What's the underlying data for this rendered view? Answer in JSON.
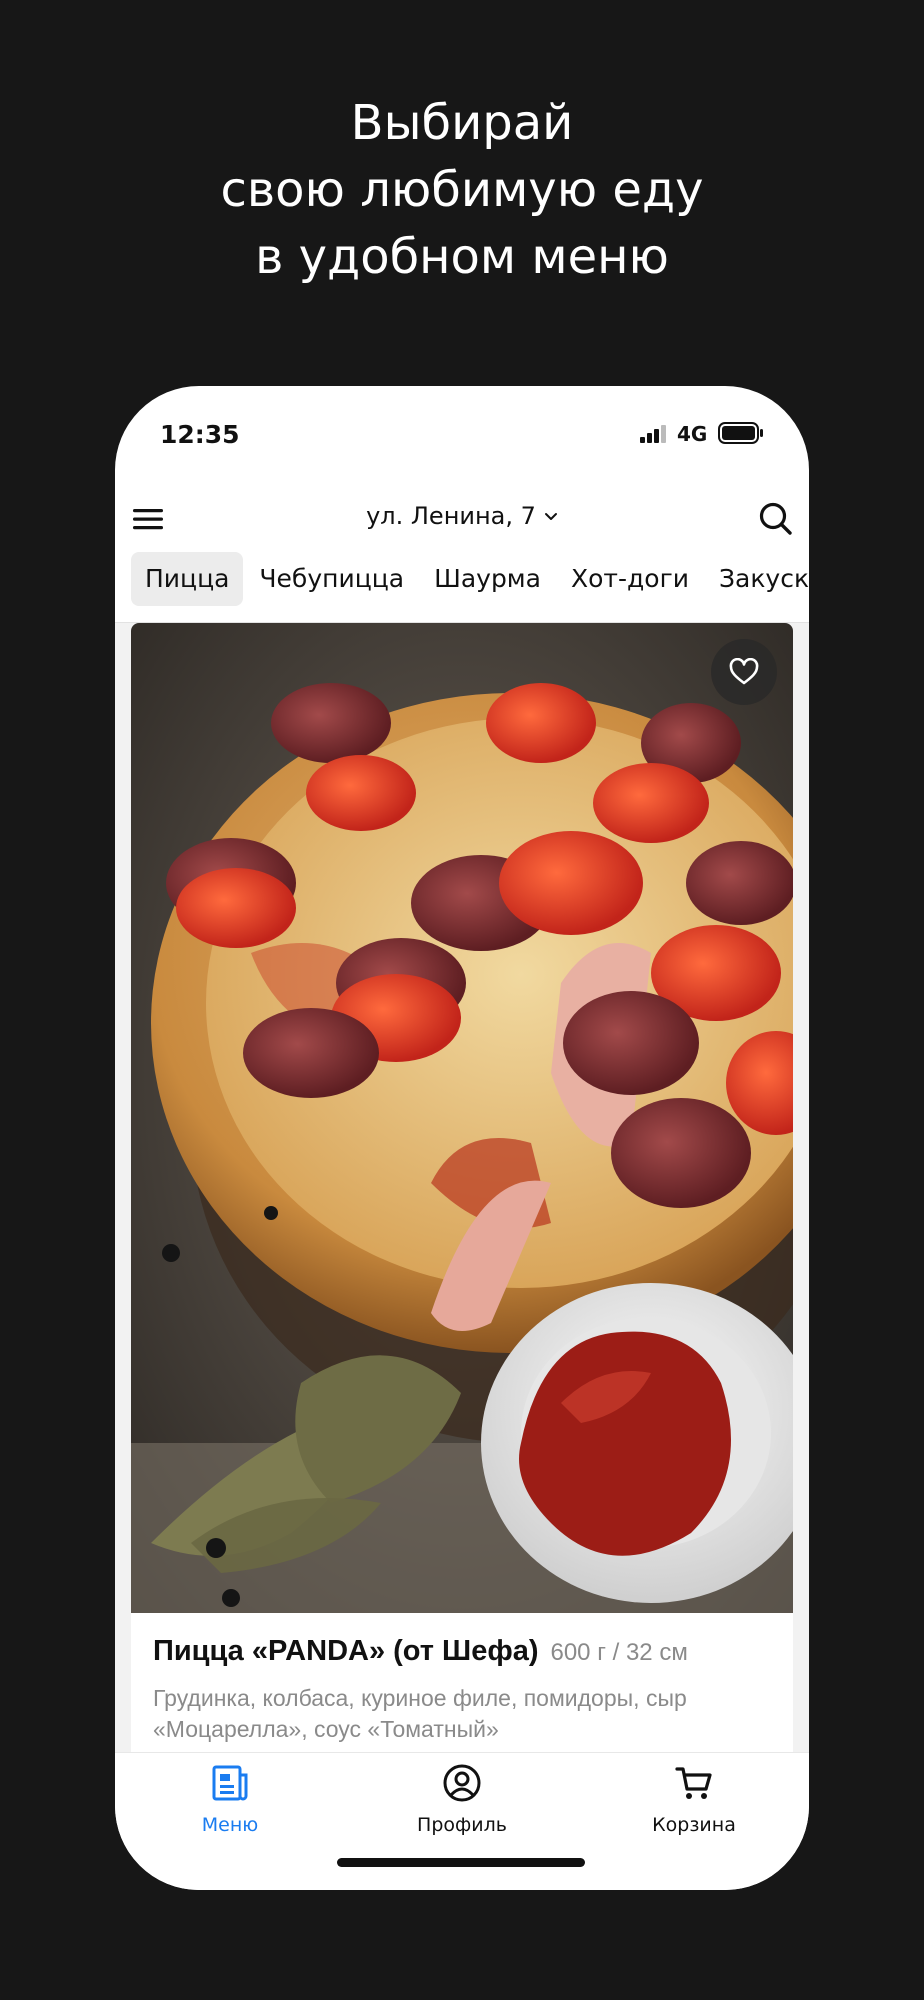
{
  "headline": {
    "line1": "Выбирай",
    "line2": "свою любимую еду",
    "line3": "в удобном меню"
  },
  "status_bar": {
    "time": "12:35",
    "network": "4G",
    "signal_icon": "signal-bars-icon",
    "battery_icon": "battery-icon"
  },
  "header": {
    "menu_icon": "hamburger-menu-icon",
    "address": "ул. Ленина, 7",
    "address_icon": "chevron-down-icon",
    "search_icon": "search-icon"
  },
  "categories": [
    {
      "label": "Пицца",
      "active": true
    },
    {
      "label": "Чебупицца",
      "active": false
    },
    {
      "label": "Шаурма",
      "active": false
    },
    {
      "label": "Хот-доги",
      "active": false
    },
    {
      "label": "Закуски",
      "active": false
    }
  ],
  "product": {
    "name": "Пицца «PANDA» (от Шефа)",
    "weight": "600 г / 32 см",
    "description": "Грудинка, колбаса, куриное филе, помидоры, сыр «Моцарелла», соус «Томатный»",
    "favorite_icon": "heart-icon"
  },
  "bottom_nav": [
    {
      "label": "Меню",
      "icon": "menu-document-icon",
      "active": true
    },
    {
      "label": "Профиль",
      "icon": "profile-icon",
      "active": false
    },
    {
      "label": "Корзина",
      "icon": "cart-icon",
      "active": false
    }
  ],
  "colors": {
    "background": "#171717",
    "accent": "#1a7cf0",
    "text_primary": "#111111",
    "text_secondary": "#8a8a8a"
  }
}
